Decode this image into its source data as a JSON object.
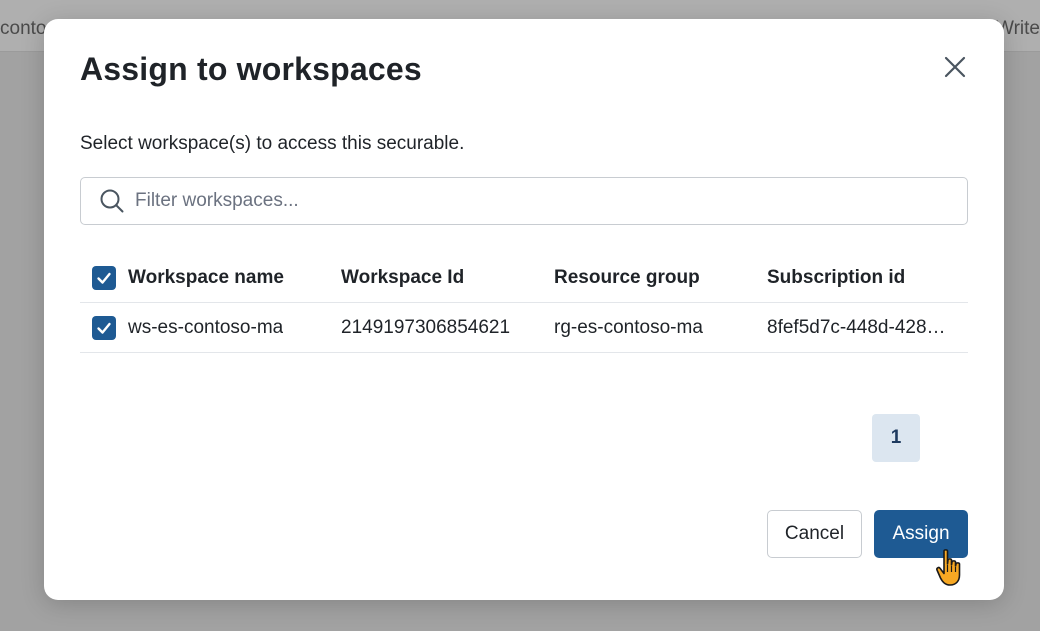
{
  "background": {
    "left_text": "contos",
    "right_text": "Write"
  },
  "dialog": {
    "title": "Assign to workspaces",
    "subtitle": "Select workspace(s) to access this securable.",
    "search": {
      "placeholder": "Filter workspaces...",
      "value": ""
    },
    "table": {
      "headers": [
        "Workspace name",
        "Workspace Id",
        "Resource group",
        "Subscription id"
      ],
      "header_checkbox_checked": true,
      "rows": [
        {
          "checked": true,
          "workspace_name": "ws-es-contoso-ma",
          "workspace_id": "2149197306854621",
          "resource_group": "rg-es-contoso-ma",
          "subscription_id": "8fef5d7c-448d-428…"
        }
      ]
    },
    "pagination": {
      "current_page": "1"
    },
    "buttons": {
      "cancel": "Cancel",
      "assign": "Assign"
    },
    "colors": {
      "primary": "#1e5a93",
      "pager_bg": "#dce6f0"
    },
    "icons": {
      "close": "close-icon",
      "search": "search-icon",
      "check": "check-icon",
      "cursor": "hand-pointer-icon"
    }
  }
}
